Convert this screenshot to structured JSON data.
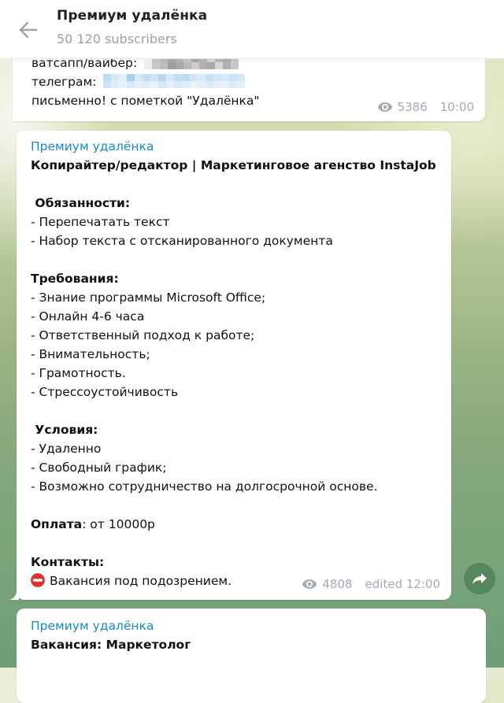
{
  "header": {
    "back_label": "Back",
    "title": "Премиум удалёнка",
    "subtitle": "50 120 subscribers"
  },
  "messages": [
    {
      "lines": [
        {
          "label": "ватсапп/вайбер:",
          "redacted": "phone number (pixelated)"
        },
        {
          "label": "телеграм:",
          "redacted": "telegram handle (pixelated)"
        },
        {
          "text": "письменно! с пометкой \"Удалёнка\""
        }
      ],
      "views": "5386",
      "time": "10:00"
    },
    {
      "sender": "Премиум удалёнка",
      "title": "Копирайтер/редактор | Маркетинговое агенство InstaJob",
      "sections": [
        {
          "heading": " Обязанности:",
          "items": [
            "- Перепечатать текст",
            "- Набор текста с отсканированного документа"
          ]
        },
        {
          "heading": "Требования:",
          "items": [
            "- Знание программы Microsoft Office;",
            "- Онлайн 4-6 часа",
            "- Ответственный подход к работе;",
            "- Внимательность;",
            "- Грамотность.",
            "- Стрессоустойчивость"
          ]
        },
        {
          "heading": " Условия:",
          "items": [
            "- Удаленно",
            "- Свободный график;",
            "- Возможно сотрудничество на долгосрочной основе."
          ]
        }
      ],
      "payment_label": "Оплата",
      "payment_value": ": от 10000р",
      "contacts_label": "Контакты:",
      "warning_text": "Вакансия под подозрением.",
      "views": "4808",
      "edited_time": "edited 12:00"
    },
    {
      "sender": "Премиум удалёнка",
      "title": "Вакансия: Маркетолог"
    }
  ],
  "icons": {
    "back": "arrow-left-icon",
    "views": "eye-icon",
    "warning": "no-entry-icon",
    "share": "share-arrow-icon"
  },
  "colors": {
    "accent": "#168acd",
    "meta": "#a3acb4",
    "share_button": "#4e8256",
    "warning": "#e0312b"
  }
}
